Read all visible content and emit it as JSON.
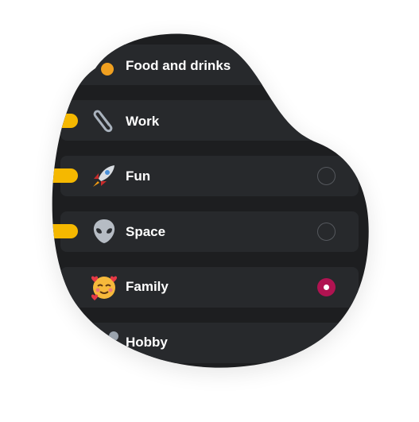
{
  "categories": [
    {
      "label": "Food and drinks",
      "icon": "food-icon",
      "selected": false
    },
    {
      "label": "Work",
      "icon": "paperclip-icon",
      "selected": false
    },
    {
      "label": "Fun",
      "icon": "rocket-icon",
      "selected": false
    },
    {
      "label": "Space",
      "icon": "alien-icon",
      "selected": false
    },
    {
      "label": "Family",
      "icon": "smiling-face-with-hearts-icon",
      "selected": true
    },
    {
      "label": "Hobby",
      "icon": "hobby-icon",
      "selected": false
    }
  ],
  "colors": {
    "background": "#1d1e20",
    "row": "#27292c",
    "tag": "#f5b800",
    "radio_selected": "#b01351",
    "text": "#ffffff"
  }
}
